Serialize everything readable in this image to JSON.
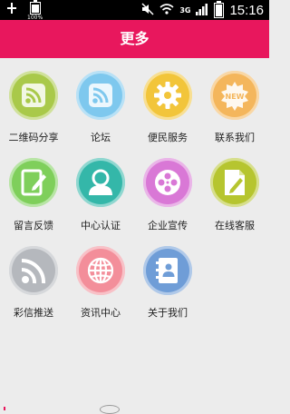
{
  "status_bar": {
    "battery_percent": "100%",
    "network": "3G",
    "time": "15:16"
  },
  "title": "更多",
  "colors": {
    "title_bar": "#e8175d",
    "background": "#ececec"
  },
  "menu_items": [
    {
      "label": "二维码分享",
      "icon": "rss-icon",
      "color": "#a9c94a"
    },
    {
      "label": "论坛",
      "icon": "rss-icon",
      "color": "#7ec8ee"
    },
    {
      "label": "便民服务",
      "icon": "gear-icon",
      "color": "#f2c53a"
    },
    {
      "label": "联系我们",
      "icon": "new-badge-icon",
      "color": "#f4b65c"
    },
    {
      "label": "留言反馈",
      "icon": "edit-icon",
      "color": "#7fcf5b"
    },
    {
      "label": "中心认证",
      "icon": "user-icon",
      "color": "#34b7a9"
    },
    {
      "label": "企业宣传",
      "icon": "film-reel-icon",
      "color": "#d978d6"
    },
    {
      "label": "在线客服",
      "icon": "document-edit-icon",
      "color": "#b6c52f"
    },
    {
      "label": "彩信推送",
      "icon": "rss-icon",
      "color": "#b5b8bd"
    },
    {
      "label": "资讯中心",
      "icon": "globe-icon",
      "color": "#f38e9a"
    },
    {
      "label": "关于我们",
      "icon": "contacts-book-icon",
      "color": "#6f9dd7"
    }
  ]
}
